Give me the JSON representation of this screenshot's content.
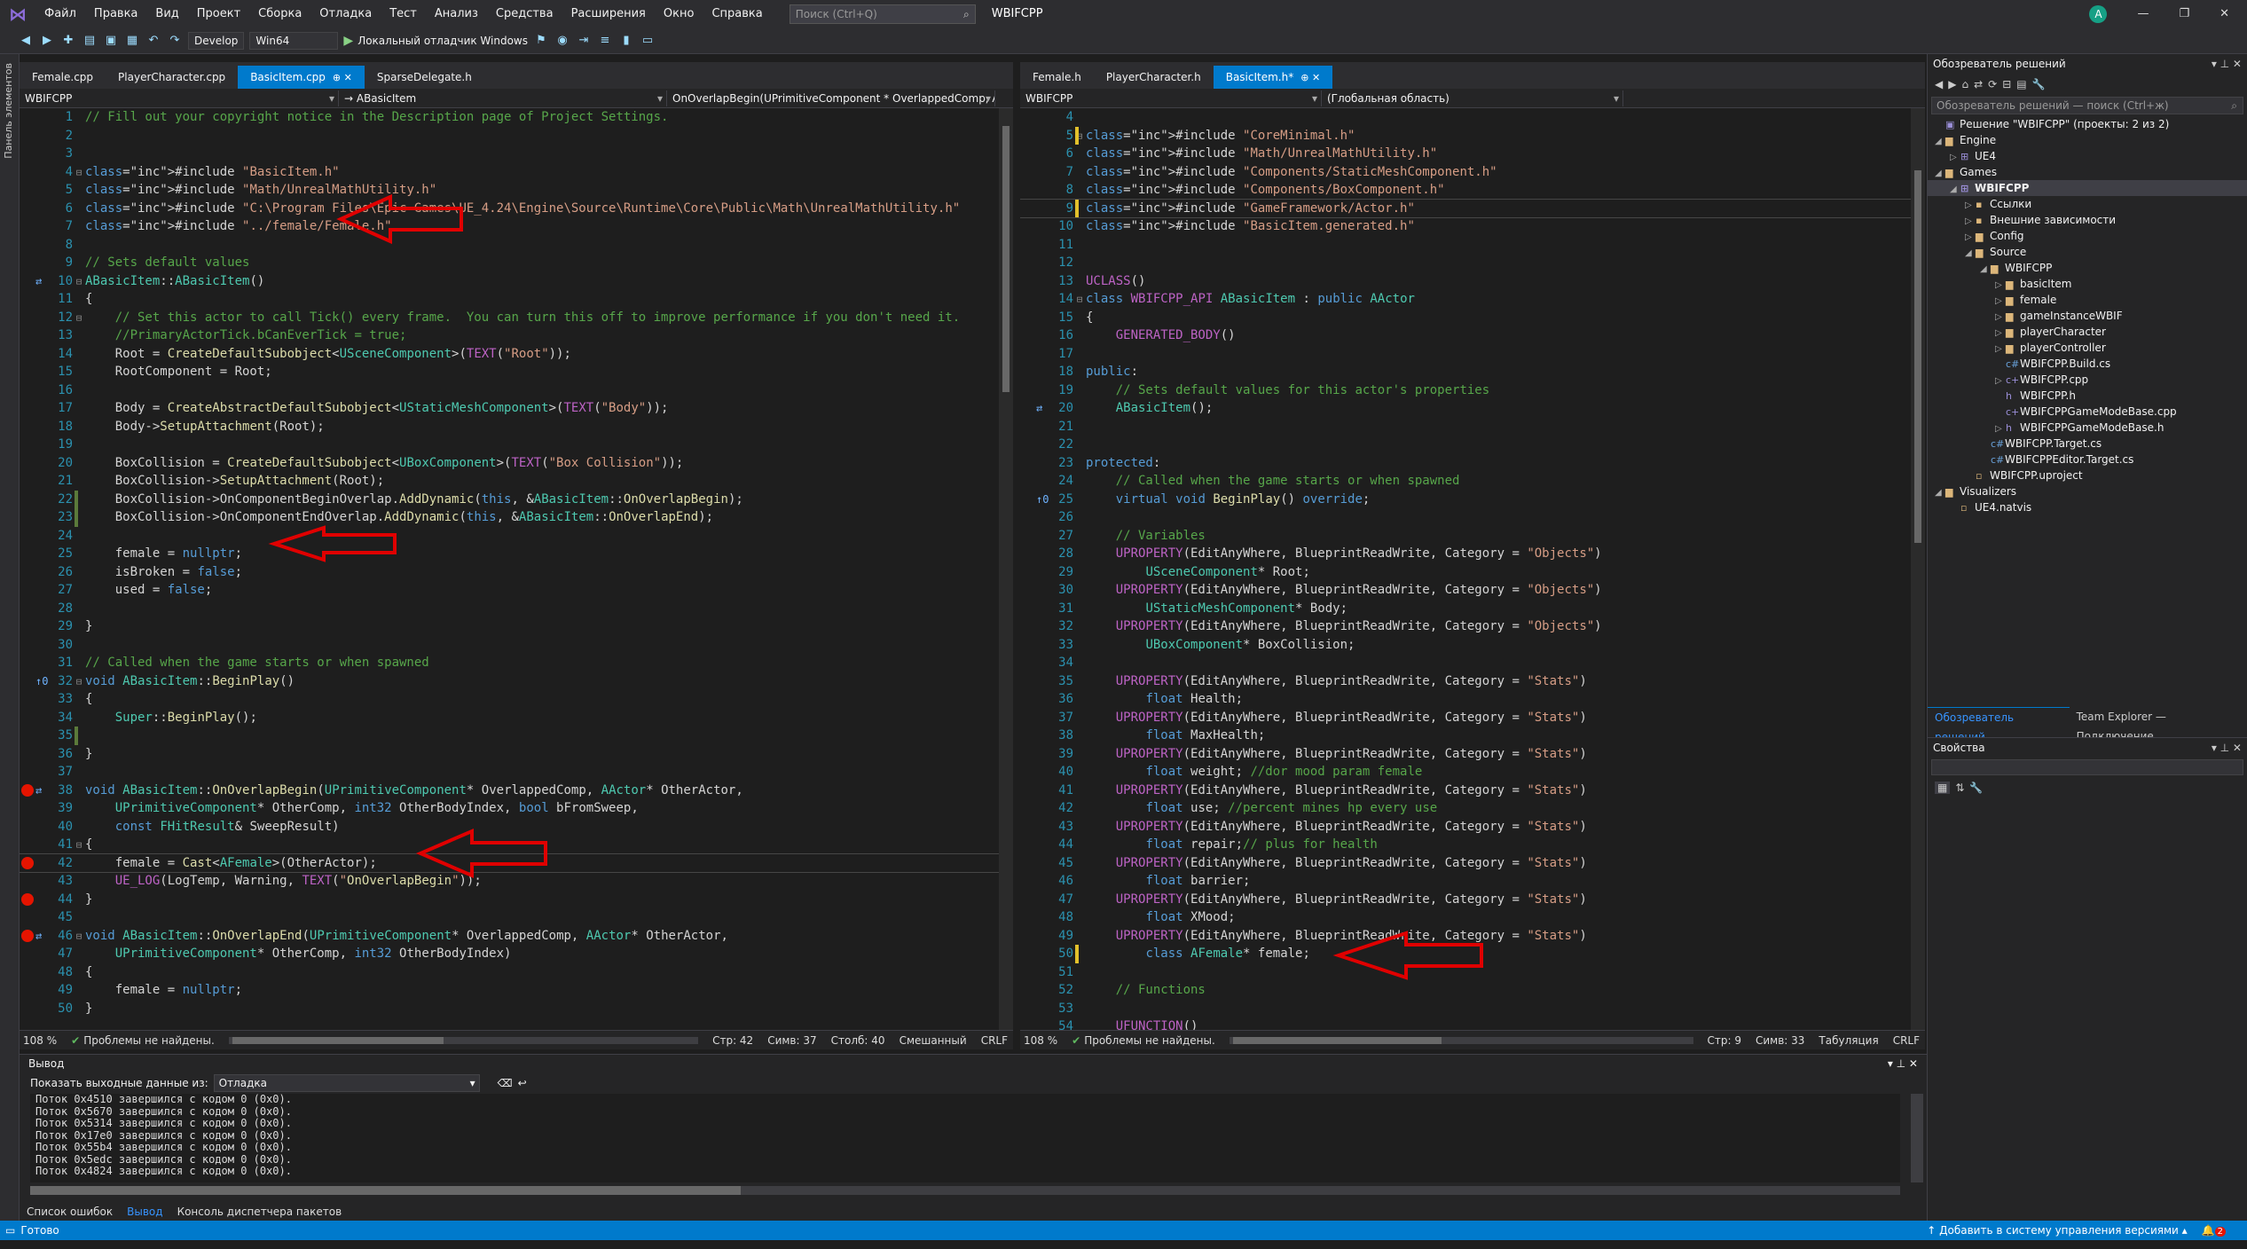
{
  "menu": {
    "items": [
      "Файл",
      "Правка",
      "Вид",
      "Проект",
      "Сборка",
      "Отладка",
      "Тест",
      "Анализ",
      "Средства",
      "Расширения",
      "Окно",
      "Справка"
    ],
    "search_placeholder": "Поиск (Ctrl+Q)",
    "solution_title": "WBIFCPP",
    "avatar_letter": "A"
  },
  "toolbar": {
    "config": "Develop",
    "platform": "Win64",
    "run_label": "Локальный отладчик Windows"
  },
  "left_toolbox_label": "Панель элементов",
  "left_editor": {
    "tabs": [
      "Female.cpp",
      "PlayerCharacter.cpp",
      "BasicItem.cpp",
      "SparseDelegate.h"
    ],
    "nav_project": "WBIFCPP",
    "nav_scope": "→ ABasicItem",
    "nav_member": "OnOverlapBegin(UPrimitiveComponent * OverlappedComp, AA",
    "status": {
      "zoom": "108 %",
      "problems": "Проблемы не найдены.",
      "line": "Стр: 42",
      "sym": "Симв: 37",
      "col": "Столб: 40",
      "mode": "Смешанный",
      "eol": "CRLF"
    }
  },
  "right_editor": {
    "tabs": [
      "Female.h",
      "PlayerCharacter.h",
      "BasicItem.h*"
    ],
    "nav_project": "WBIFCPP",
    "nav_scope": "(Глобальная область)",
    "status": {
      "zoom": "108 %",
      "problems": "Проблемы не найдены.",
      "line": "Стр: 9",
      "sym": "Симв: 33",
      "mode": "Табуляция",
      "eol": "CRLF"
    }
  },
  "left_code": [
    {
      "n": "1",
      "t": "// Fill out your copyright notice in the Description page of Project Settings."
    },
    {
      "n": "2",
      "t": ""
    },
    {
      "n": "3",
      "t": ""
    },
    {
      "n": "4",
      "t": "#include \"BasicItem.h\""
    },
    {
      "n": "5",
      "t": "#include \"Math/UnrealMathUtility.h\""
    },
    {
      "n": "6",
      "t": "#include \"C:\\Program Files\\Epic Games\\UE_4.24\\Engine\\Source\\Runtime\\Core\\Public\\Math\\UnrealMathUtility.h\""
    },
    {
      "n": "7",
      "t": "#include \"../female/Female.h\""
    },
    {
      "n": "8",
      "t": ""
    },
    {
      "n": "9",
      "t": "// Sets default values"
    },
    {
      "n": "10",
      "t": "ABasicItem::ABasicItem()"
    },
    {
      "n": "11",
      "t": "{"
    },
    {
      "n": "12",
      "t": "    // Set this actor to call Tick() every frame.  You can turn this off to improve performance if you don't need it."
    },
    {
      "n": "13",
      "t": "    //PrimaryActorTick.bCanEverTick = true;"
    },
    {
      "n": "14",
      "t": "    Root = CreateDefaultSubobject<USceneComponent>(TEXT(\"Root\"));"
    },
    {
      "n": "15",
      "t": "    RootComponent = Root;"
    },
    {
      "n": "16",
      "t": ""
    },
    {
      "n": "17",
      "t": "    Body = CreateAbstractDefaultSubobject<UStaticMeshComponent>(TEXT(\"Body\"));"
    },
    {
      "n": "18",
      "t": "    Body->SetupAttachment(Root);"
    },
    {
      "n": "19",
      "t": ""
    },
    {
      "n": "20",
      "t": "    BoxCollision = CreateDefaultSubobject<UBoxComponent>(TEXT(\"Box Collision\"));"
    },
    {
      "n": "21",
      "t": "    BoxCollision->SetupAttachment(Root);"
    },
    {
      "n": "22",
      "t": "    BoxCollision->OnComponentBeginOverlap.AddDynamic(this, &ABasicItem::OnOverlapBegin);"
    },
    {
      "n": "23",
      "t": "    BoxCollision->OnComponentEndOverlap.AddDynamic(this, &ABasicItem::OnOverlapEnd);"
    },
    {
      "n": "24",
      "t": ""
    },
    {
      "n": "25",
      "t": "    female = nullptr;"
    },
    {
      "n": "26",
      "t": "    isBroken = false;"
    },
    {
      "n": "27",
      "t": "    used = false;"
    },
    {
      "n": "28",
      "t": ""
    },
    {
      "n": "29",
      "t": "}"
    },
    {
      "n": "30",
      "t": ""
    },
    {
      "n": "31",
      "t": "// Called when the game starts or when spawned"
    },
    {
      "n": "32",
      "t": "void ABasicItem::BeginPlay()"
    },
    {
      "n": "33",
      "t": "{"
    },
    {
      "n": "34",
      "t": "    Super::BeginPlay();"
    },
    {
      "n": "35",
      "t": ""
    },
    {
      "n": "36",
      "t": "}"
    },
    {
      "n": "37",
      "t": ""
    },
    {
      "n": "38",
      "t": "void ABasicItem::OnOverlapBegin(UPrimitiveComponent* OverlappedComp, AActor* OtherActor,"
    },
    {
      "n": "39",
      "t": "    UPrimitiveComponent* OtherComp, int32 OtherBodyIndex, bool bFromSweep,"
    },
    {
      "n": "40",
      "t": "    const FHitResult& SweepResult)"
    },
    {
      "n": "41",
      "t": "{"
    },
    {
      "n": "42",
      "t": "    female = Cast<AFemale>(OtherActor);"
    },
    {
      "n": "43",
      "t": "    UE_LOG(LogTemp, Warning, TEXT(\"OnOverlapBegin\"));"
    },
    {
      "n": "44",
      "t": "}"
    },
    {
      "n": "45",
      "t": ""
    },
    {
      "n": "46",
      "t": "void ABasicItem::OnOverlapEnd(UPrimitiveComponent* OverlappedComp, AActor* OtherActor,"
    },
    {
      "n": "47",
      "t": "    UPrimitiveComponent* OtherComp, int32 OtherBodyIndex)"
    },
    {
      "n": "48",
      "t": "{"
    },
    {
      "n": "49",
      "t": "    female = nullptr;"
    },
    {
      "n": "50",
      "t": "}"
    }
  ],
  "right_code": [
    {
      "n": "4",
      "t": ""
    },
    {
      "n": "5",
      "t": "#include \"CoreMinimal.h\""
    },
    {
      "n": "6",
      "t": "#include \"Math/UnrealMathUtility.h\""
    },
    {
      "n": "7",
      "t": "#include \"Components/StaticMeshComponent.h\""
    },
    {
      "n": "8",
      "t": "#include \"Components/BoxComponent.h\""
    },
    {
      "n": "9",
      "t": "#include \"GameFramework/Actor.h\""
    },
    {
      "n": "10",
      "t": "#include \"BasicItem.generated.h\""
    },
    {
      "n": "11",
      "t": ""
    },
    {
      "n": "12",
      "t": ""
    },
    {
      "n": "13",
      "t": "UCLASS()"
    },
    {
      "n": "14",
      "t": "class WBIFCPP_API ABasicItem : public AActor"
    },
    {
      "n": "15",
      "t": "{"
    },
    {
      "n": "16",
      "t": "    GENERATED_BODY()"
    },
    {
      "n": "17",
      "t": ""
    },
    {
      "n": "18",
      "t": "public:"
    },
    {
      "n": "19",
      "t": "    // Sets default values for this actor's properties"
    },
    {
      "n": "20",
      "t": "    ABasicItem();"
    },
    {
      "n": "21",
      "t": ""
    },
    {
      "n": "22",
      "t": ""
    },
    {
      "n": "23",
      "t": "protected:"
    },
    {
      "n": "24",
      "t": "    // Called when the game starts or when spawned"
    },
    {
      "n": "25",
      "t": "    virtual void BeginPlay() override;"
    },
    {
      "n": "26",
      "t": ""
    },
    {
      "n": "27",
      "t": "    // Variables"
    },
    {
      "n": "28",
      "t": "    UPROPERTY(EditAnyWhere, BlueprintReadWrite, Category = \"Objects\")"
    },
    {
      "n": "29",
      "t": "        USceneComponent* Root;"
    },
    {
      "n": "30",
      "t": "    UPROPERTY(EditAnyWhere, BlueprintReadWrite, Category = \"Objects\")"
    },
    {
      "n": "31",
      "t": "        UStaticMeshComponent* Body;"
    },
    {
      "n": "32",
      "t": "    UPROPERTY(EditAnyWhere, BlueprintReadWrite, Category = \"Objects\")"
    },
    {
      "n": "33",
      "t": "        UBoxComponent* BoxCollision;"
    },
    {
      "n": "34",
      "t": ""
    },
    {
      "n": "35",
      "t": "    UPROPERTY(EditAnyWhere, BlueprintReadWrite, Category = \"Stats\")"
    },
    {
      "n": "36",
      "t": "        float Health;"
    },
    {
      "n": "37",
      "t": "    UPROPERTY(EditAnyWhere, BlueprintReadWrite, Category = \"Stats\")"
    },
    {
      "n": "38",
      "t": "        float MaxHealth;"
    },
    {
      "n": "39",
      "t": "    UPROPERTY(EditAnyWhere, BlueprintReadWrite, Category = \"Stats\")"
    },
    {
      "n": "40",
      "t": "        float weight; //dor mood param female"
    },
    {
      "n": "41",
      "t": "    UPROPERTY(EditAnyWhere, BlueprintReadWrite, Category = \"Stats\")"
    },
    {
      "n": "42",
      "t": "        float use; //percent mines hp every use"
    },
    {
      "n": "43",
      "t": "    UPROPERTY(EditAnyWhere, BlueprintReadWrite, Category = \"Stats\")"
    },
    {
      "n": "44",
      "t": "        float repair;// plus for health"
    },
    {
      "n": "45",
      "t": "    UPROPERTY(EditAnyWhere, BlueprintReadWrite, Category = \"Stats\")"
    },
    {
      "n": "46",
      "t": "        float barrier;"
    },
    {
      "n": "47",
      "t": "    UPROPERTY(EditAnyWhere, BlueprintReadWrite, Category = \"Stats\")"
    },
    {
      "n": "48",
      "t": "        float XMood;"
    },
    {
      "n": "49",
      "t": "    UPROPERTY(EditAnyWhere, BlueprintReadWrite, Category = \"Stats\")"
    },
    {
      "n": "50",
      "t": "        class AFemale* female;"
    },
    {
      "n": "51",
      "t": ""
    },
    {
      "n": "52",
      "t": "    // Functions"
    },
    {
      "n": "53",
      "t": ""
    },
    {
      "n": "54",
      "t": "    UFUNCTION()"
    }
  ],
  "solution_explorer": {
    "title": "Обозреватель решений",
    "search_placeholder": "Обозреватель решений — поиск (Ctrl+ж)",
    "items": [
      {
        "label": "Решение \"WBIFCPP\" (проекты: 2 из 2)",
        "icon": "solution-icon",
        "lvl": 0,
        "tw": ""
      },
      {
        "label": "Engine",
        "icon": "folder-icon",
        "lvl": 0,
        "tw": "▲"
      },
      {
        "label": "UE4",
        "icon": "project-icon",
        "lvl": 1,
        "tw": "▶"
      },
      {
        "label": "Games",
        "icon": "folder-icon",
        "lvl": 0,
        "tw": "▲"
      },
      {
        "label": "WBIFCPP",
        "icon": "project-icon",
        "lvl": 1,
        "tw": "▲",
        "sel": true
      },
      {
        "label": "Ссылки",
        "icon": "references-icon",
        "lvl": 2,
        "tw": "▶"
      },
      {
        "label": "Внешние зависимости",
        "icon": "dependencies-icon",
        "lvl": 2,
        "tw": "▶"
      },
      {
        "label": "Config",
        "icon": "folder-icon",
        "lvl": 2,
        "tw": "▶"
      },
      {
        "label": "Source",
        "icon": "folder-icon",
        "lvl": 2,
        "tw": "▲"
      },
      {
        "label": "WBIFCPP",
        "icon": "folder-icon",
        "lvl": 3,
        "tw": "▲"
      },
      {
        "label": "basicItem",
        "icon": "folder-icon",
        "lvl": 4,
        "tw": "▶"
      },
      {
        "label": "female",
        "icon": "folder-icon",
        "lvl": 4,
        "tw": "▶"
      },
      {
        "label": "gameInstanceWBIF",
        "icon": "folder-icon",
        "lvl": 4,
        "tw": "▶"
      },
      {
        "label": "playerCharacter",
        "icon": "folder-icon",
        "lvl": 4,
        "tw": "▶"
      },
      {
        "label": "playerController",
        "icon": "folder-icon",
        "lvl": 4,
        "tw": "▶"
      },
      {
        "label": "WBIFCPP.Build.cs",
        "icon": "csharp-file-icon",
        "lvl": 4,
        "tw": ""
      },
      {
        "label": "WBIFCPP.cpp",
        "icon": "cpp-file-icon",
        "lvl": 4,
        "tw": "▶"
      },
      {
        "label": "WBIFCPP.h",
        "icon": "header-file-icon",
        "lvl": 4,
        "tw": ""
      },
      {
        "label": "WBIFCPPGameModeBase.cpp",
        "icon": "cpp-file-icon",
        "lvl": 4,
        "tw": ""
      },
      {
        "label": "WBIFCPPGameModeBase.h",
        "icon": "header-file-icon",
        "lvl": 4,
        "tw": "▶"
      },
      {
        "label": "WBIFCPP.Target.cs",
        "icon": "csharp-file-icon",
        "lvl": 3,
        "tw": ""
      },
      {
        "label": "WBIFCPPEditor.Target.cs",
        "icon": "csharp-file-icon",
        "lvl": 3,
        "tw": ""
      },
      {
        "label": "WBIFCPP.uproject",
        "icon": "file-icon",
        "lvl": 2,
        "tw": ""
      },
      {
        "label": "Visualizers",
        "icon": "folder-icon",
        "lvl": 0,
        "tw": "▲"
      },
      {
        "label": "UE4.natvis",
        "icon": "file-icon",
        "lvl": 1,
        "tw": ""
      }
    ],
    "tabs": [
      "Обозреватель решений",
      "Team Explorer — Подключение"
    ]
  },
  "properties": {
    "title": "Свойства"
  },
  "output": {
    "title": "Вывод",
    "source_label": "Показать выходные данные из:",
    "source_value": "Отладка",
    "lines": [
      "Поток 0x4510 завершился с кодом 0 (0x0).",
      "Поток 0x5670 завершился с кодом 0 (0x0).",
      "Поток 0x5314 завершился с кодом 0 (0x0).",
      "Поток 0x17e0 завершился с кодом 0 (0x0).",
      "Поток 0x55b4 завершился с кодом 0 (0x0).",
      "Поток 0x5edc завершился с кодом 0 (0x0).",
      "Поток 0x4824 завершился с кодом 0 (0x0)."
    ],
    "tabs": [
      "Список ошибок",
      "Вывод",
      "Консоль диспетчера пакетов"
    ]
  },
  "statusbar": {
    "ready": "Готово",
    "vcs": "Добавить в систему управления версиями",
    "notifications": "2"
  },
  "colors": {
    "accent": "#007acc",
    "arrow": "#e00000",
    "breakpoint": "#e51400"
  }
}
